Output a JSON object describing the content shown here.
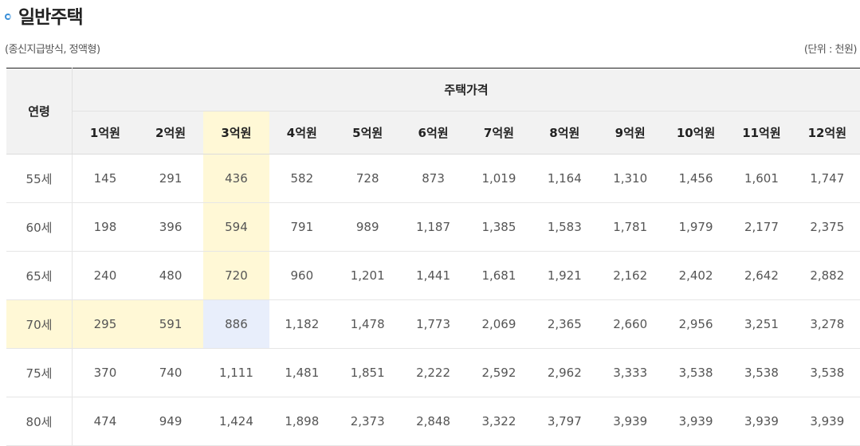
{
  "header": {
    "title": "일반주택",
    "subtitle": "(종신지급방식, 정액형)",
    "unit": "(단위 : 천원)"
  },
  "table": {
    "age_header": "연령",
    "price_group_header": "주택가격",
    "price_columns": [
      "1억원",
      "2억원",
      "3억원",
      "4억원",
      "5억원",
      "6억원",
      "7억원",
      "8억원",
      "9억원",
      "10억원",
      "11억원",
      "12억원"
    ],
    "rows": [
      {
        "age": "55세",
        "values": [
          "145",
          "291",
          "436",
          "582",
          "728",
          "873",
          "1,019",
          "1,164",
          "1,310",
          "1,456",
          "1,601",
          "1,747"
        ]
      },
      {
        "age": "60세",
        "values": [
          "198",
          "396",
          "594",
          "791",
          "989",
          "1,187",
          "1,385",
          "1,583",
          "1,781",
          "1,979",
          "2,177",
          "2,375"
        ]
      },
      {
        "age": "65세",
        "values": [
          "240",
          "480",
          "720",
          "960",
          "1,201",
          "1,441",
          "1,681",
          "1,921",
          "2,162",
          "2,402",
          "2,642",
          "2,882"
        ]
      },
      {
        "age": "70세",
        "values": [
          "295",
          "591",
          "886",
          "1,182",
          "1,478",
          "1,773",
          "2,069",
          "2,365",
          "2,660",
          "2,956",
          "3,251",
          "3,278"
        ]
      },
      {
        "age": "75세",
        "values": [
          "370",
          "740",
          "1,111",
          "1,481",
          "1,851",
          "2,222",
          "2,592",
          "2,962",
          "3,333",
          "3,538",
          "3,538",
          "3,538"
        ]
      },
      {
        "age": "80세",
        "values": [
          "474",
          "949",
          "1,424",
          "1,898",
          "2,373",
          "2,848",
          "3,322",
          "3,797",
          "3,939",
          "3,939",
          "3,939",
          "3,939"
        ]
      }
    ]
  },
  "colors": {
    "highlight": "#fff8d6",
    "crosshair": "#e8eefb",
    "header_bg": "#f2f2f2",
    "bullet": "#3a8fd8"
  }
}
